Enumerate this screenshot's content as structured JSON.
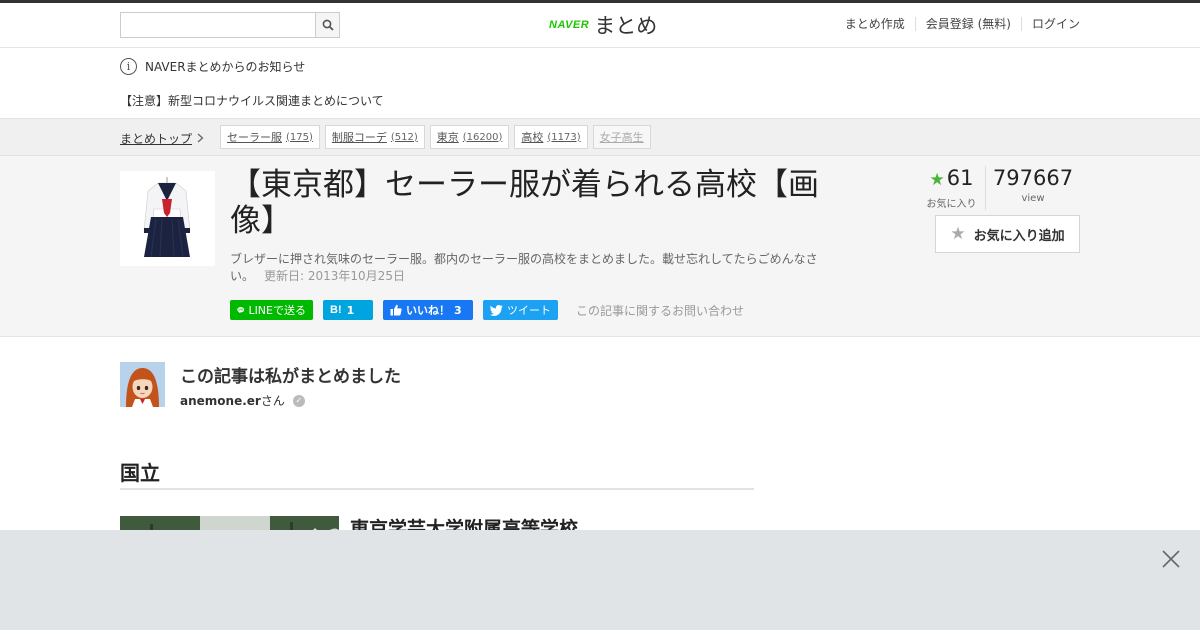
{
  "header": {
    "search_placeholder": "",
    "logo_brand": "NAVER",
    "logo_text": "まとめ",
    "nav": [
      "まとめ作成",
      "会員登録 (無料)",
      "ログイン"
    ]
  },
  "notice": {
    "heading": "NAVERまとめからのお知らせ",
    "link": "【注意】新型コロナウイルス関連まとめについて"
  },
  "breadcrumb": {
    "home": "まとめトップ",
    "tags": [
      {
        "label": "セーラー服",
        "count": "(175)"
      },
      {
        "label": "制服コーデ",
        "count": "(512)"
      },
      {
        "label": "東京",
        "count": "(16200)"
      },
      {
        "label": "高校",
        "count": "(1173)"
      },
      {
        "label": "女子高生",
        "count": ""
      }
    ]
  },
  "article": {
    "title": "【東京都】セーラー服が着られる高校【画像】",
    "description": "ブレザーに押され気味のセーラー服。都内のセーラー服の高校をまとめました。載せ忘れしてたらごめんなさい。",
    "updated": "更新日: 2013年10月25日",
    "share": {
      "line": "LINEで送る",
      "hatena_count": "1",
      "fb_label": "いいね！",
      "fb_count": "3",
      "tweet": "ツイート",
      "inquiry": "この記事に関するお問い合わせ"
    },
    "stats": {
      "favorites": "61",
      "favorites_label": "お気に入り",
      "views": "797667",
      "views_label": "view"
    },
    "fav_button": "お気に入り追加"
  },
  "author": {
    "heading": "この記事は私がまとめました",
    "name": "anemone.er",
    "suffix": "さん"
  },
  "section": {
    "heading": "国立",
    "item_title": "東京学芸大学附属高等学校"
  },
  "colors": {
    "line_green": "#00b900",
    "hatena_blue": "#00a4de",
    "facebook_blue": "#1877f2",
    "twitter_blue": "#1da1f2",
    "fav_star": "#4ab43a"
  }
}
